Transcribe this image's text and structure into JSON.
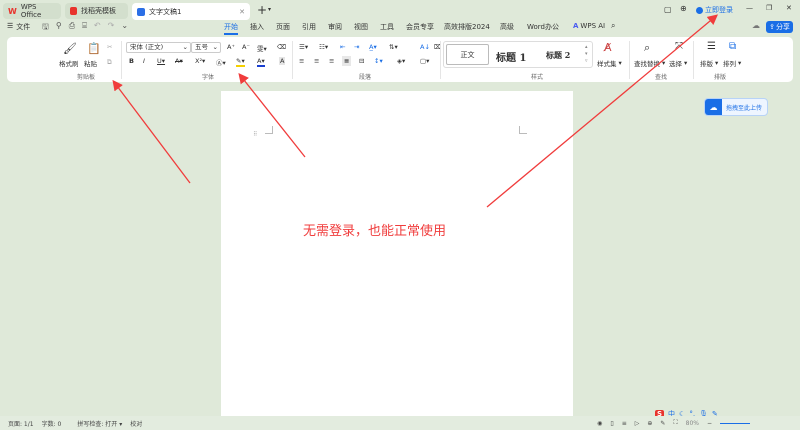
{
  "tabs": [
    {
      "label": "WPS Office"
    },
    {
      "label": "找稻壳模板"
    },
    {
      "label": "文字文稿1"
    }
  ],
  "title_bar": {
    "login": "立即登录"
  },
  "quick": {
    "file": "文件"
  },
  "menu": [
    "开始",
    "插入",
    "页面",
    "引用",
    "审阅",
    "视图",
    "工具",
    "会员专享",
    "高效排版2024",
    "高级",
    "Word办公",
    "WPS AI"
  ],
  "share": "分享",
  "ribbon": {
    "format_painter": "格式刷",
    "paste": "粘贴",
    "clipboard": "剪贴板",
    "font_group": "字体",
    "paragraph": "段落",
    "styles": "样式",
    "find_group": "查找",
    "layout_group": "排版",
    "font_name": "宋体 (正文)",
    "font_size": "五号",
    "style_normal": "正文",
    "style_h1": "标题 1",
    "style_h2": "标题 2",
    "style_set": "样式集",
    "find_replace": "查找替换",
    "select": "选择",
    "typeset": "排版",
    "arrange": "排列"
  },
  "upload": "拖拽至此上传",
  "annotation": "无需登录，也能正常使用",
  "status": {
    "page": "页面: 1/1",
    "words": "字数: 0",
    "spell": "拼写检查: 打开",
    "proof": "校对",
    "zoom": "80%"
  },
  "colors": {
    "accent": "#1a6ee6",
    "annotation": "#f03c3c"
  }
}
